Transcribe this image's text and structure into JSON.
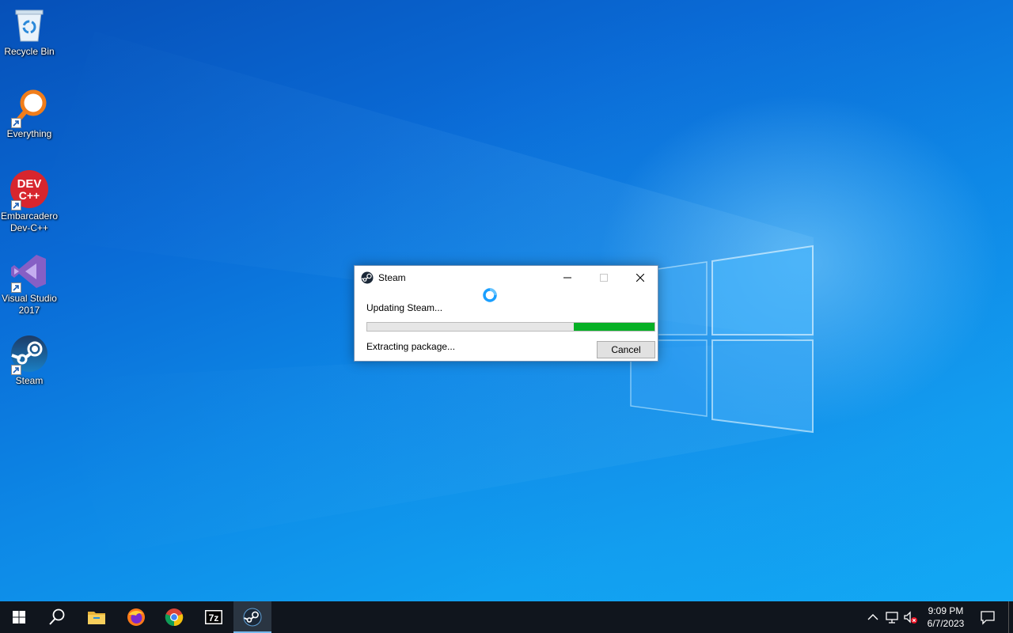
{
  "desktop": {
    "icons": [
      {
        "label": "Recycle Bin"
      },
      {
        "label": "Everything"
      },
      {
        "label": "Embarcadero\nDev-C++",
        "logo_text": "DEV\nC++"
      },
      {
        "label": "Visual Studio\n2017"
      },
      {
        "label": "Steam"
      }
    ]
  },
  "dialog": {
    "title": "Steam",
    "status": "Updating Steam...",
    "sub_status": "Extracting package...",
    "cancel_label": "Cancel",
    "progress_fraction": 0.28,
    "progress_color": "#06b025"
  },
  "taskbar": {
    "items": [
      "start-icon",
      "search-icon",
      "file-explorer-icon",
      "firefox-icon",
      "chrome-icon",
      "7zip-icon",
      "steam-icon"
    ],
    "seven_zip_text": "7z",
    "active_item": "steam-icon",
    "clock": {
      "time": "9:09 PM",
      "date": "6/7/2023"
    }
  },
  "colors": {
    "accent": "#0a6bd6",
    "taskbar": "#10151d",
    "steam_blue": "#1a9fff"
  }
}
